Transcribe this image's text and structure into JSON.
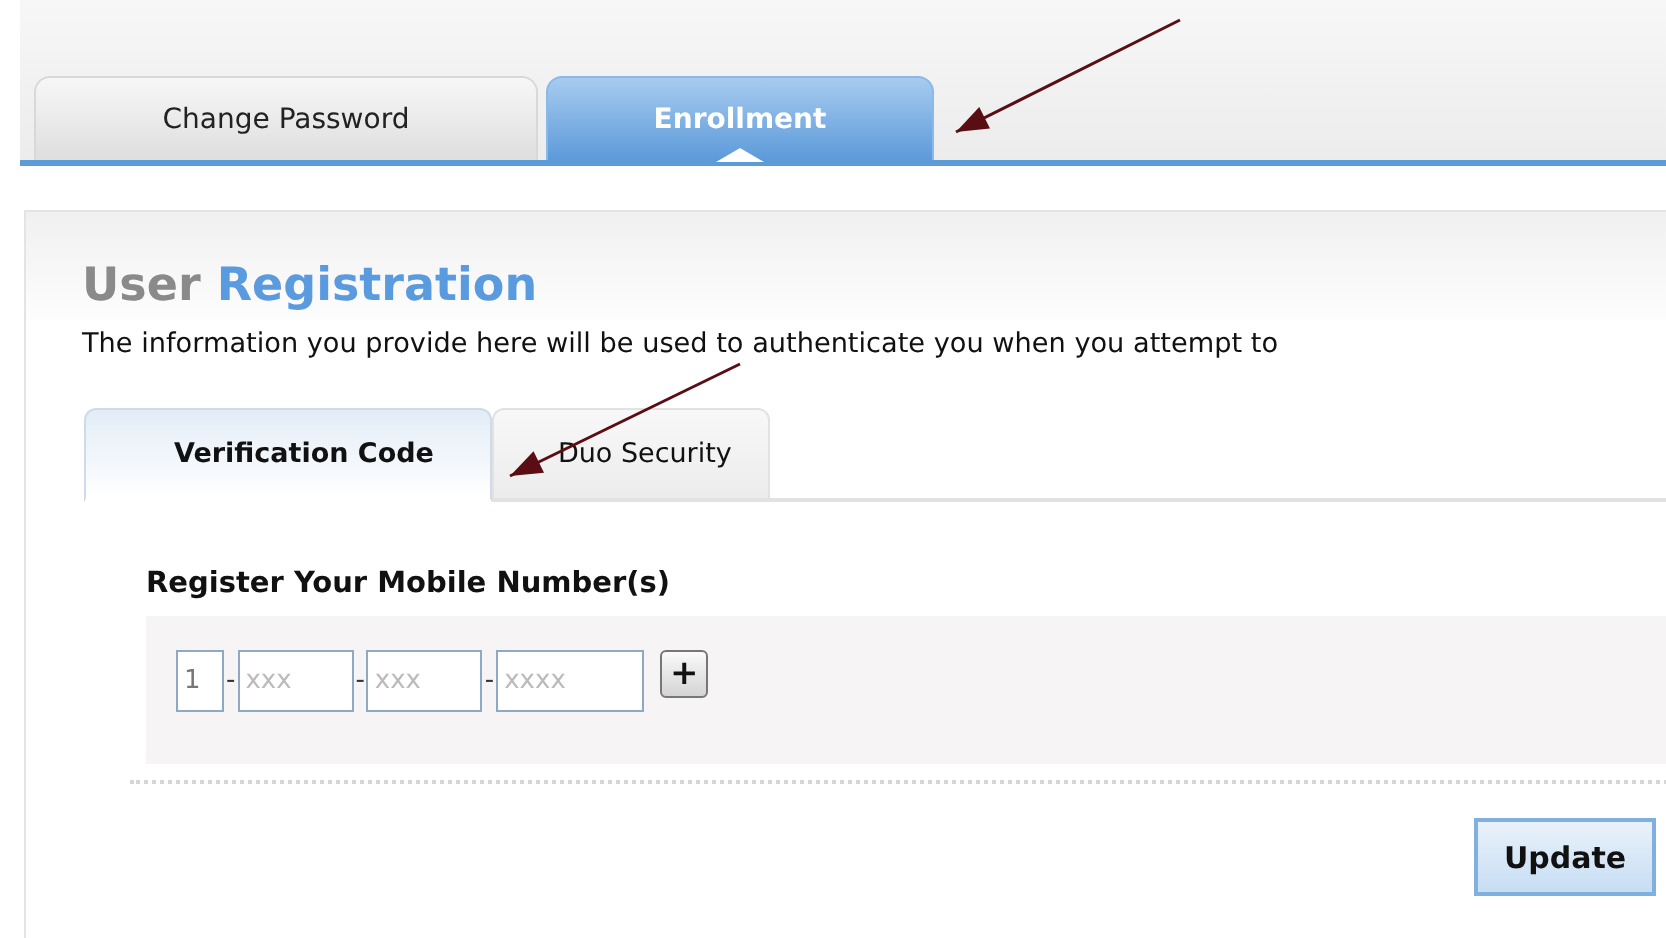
{
  "top_tabs": [
    {
      "label": "Change Password",
      "selected": false
    },
    {
      "label": "Enrollment",
      "selected": true
    }
  ],
  "title": {
    "prefix": "User",
    "main": "Registration"
  },
  "description": "The information you provide here will be used to authenticate you when you attempt to",
  "sub_tabs": [
    {
      "label": "Verification Code",
      "selected": true
    },
    {
      "label": "Duo Security",
      "selected": false
    }
  ],
  "section_heading": "Register Your Mobile Number(s)",
  "phone_fields": [
    {
      "value": "1"
    },
    {
      "placeholder": "xxx"
    },
    {
      "placeholder": "xxx"
    },
    {
      "placeholder": "xxxx"
    }
  ],
  "separator": "-",
  "add_button": "+",
  "update_button": "Update",
  "annotations": [
    {
      "kind": "arrow"
    },
    {
      "kind": "arrow"
    }
  ]
}
